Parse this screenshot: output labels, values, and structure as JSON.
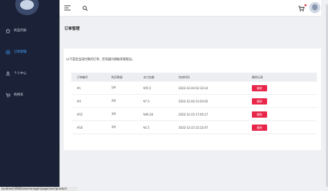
{
  "sidebar": {
    "items": [
      {
        "label": "商品列表",
        "icon": "home-icon"
      },
      {
        "label": "订单管理",
        "icon": "order-icon"
      },
      {
        "label": "个人中心",
        "icon": "user-icon"
      },
      {
        "label": "购物车",
        "icon": "cart-icon"
      }
    ]
  },
  "header": {
    "menu_icon": "hamburger-icon",
    "search_icon": "search-icon",
    "cart_icon": "cart-icon"
  },
  "main": {
    "title": "订单管理",
    "subtitle": "以下是您当成付款的订单，若有疑问请联系管理员。",
    "columns": [
      "订单编号",
      "购买数量",
      "支付金额",
      "完成时间",
      "删除记录"
    ],
    "rows": [
      {
        "id": "#1",
        "qty": "5件",
        "amount": "¥55.5",
        "time": "2022-12-04 02:33:14",
        "action": "删除"
      },
      {
        "id": "#4",
        "qty": "2件",
        "amount": "¥7.5",
        "time": "2022-12-04 12:03:02",
        "action": "删除"
      },
      {
        "id": "#15",
        "qty": "3件",
        "amount": "¥46.18",
        "time": "2022-12-22 17:05:17",
        "action": "删除"
      },
      {
        "id": "#16",
        "qty": "3件",
        "amount": "¥2.5",
        "time": "2022-12-22 22:22:47",
        "action": "删除"
      }
    ]
  },
  "statusbar": {
    "url": "localhost:8080/ukemenager/page/user/product"
  },
  "colors": {
    "sidebar_bg": "#1b2238",
    "active": "#3ea1ff",
    "delete": "#e8264a"
  }
}
